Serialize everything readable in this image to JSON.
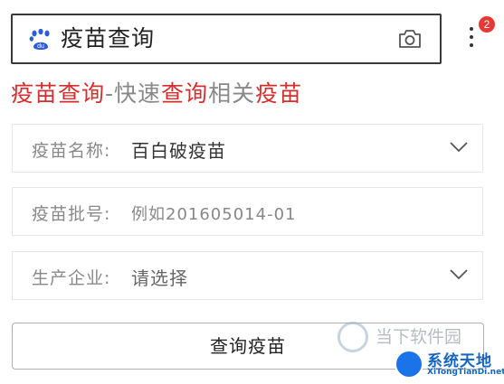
{
  "search": {
    "query": "疫苗查询",
    "notification_count": "2",
    "icons": {
      "logo": "baidu-paw-icon",
      "camera": "camera-icon",
      "more": "more-vertical-icon"
    }
  },
  "headline": {
    "part1": "疫苗查询",
    "part2": "-快速",
    "part3": "查询",
    "part4": "相关",
    "part5": "疫苗"
  },
  "form": {
    "vaccine_name": {
      "label": "疫苗名称:",
      "value": "百白破疫苗"
    },
    "batch_number": {
      "label": "疫苗批号:",
      "placeholder": "例如201605014-01"
    },
    "manufacturer": {
      "label": "生产企业:",
      "value": "请选择"
    },
    "submit_label": "查询疫苗"
  },
  "watermarks": {
    "top": "当下软件园",
    "site_name": "系统天地",
    "site_url": "XiTongTianDi.net"
  },
  "colors": {
    "accent_red": "#d32f2f",
    "badge": "#e53935"
  }
}
